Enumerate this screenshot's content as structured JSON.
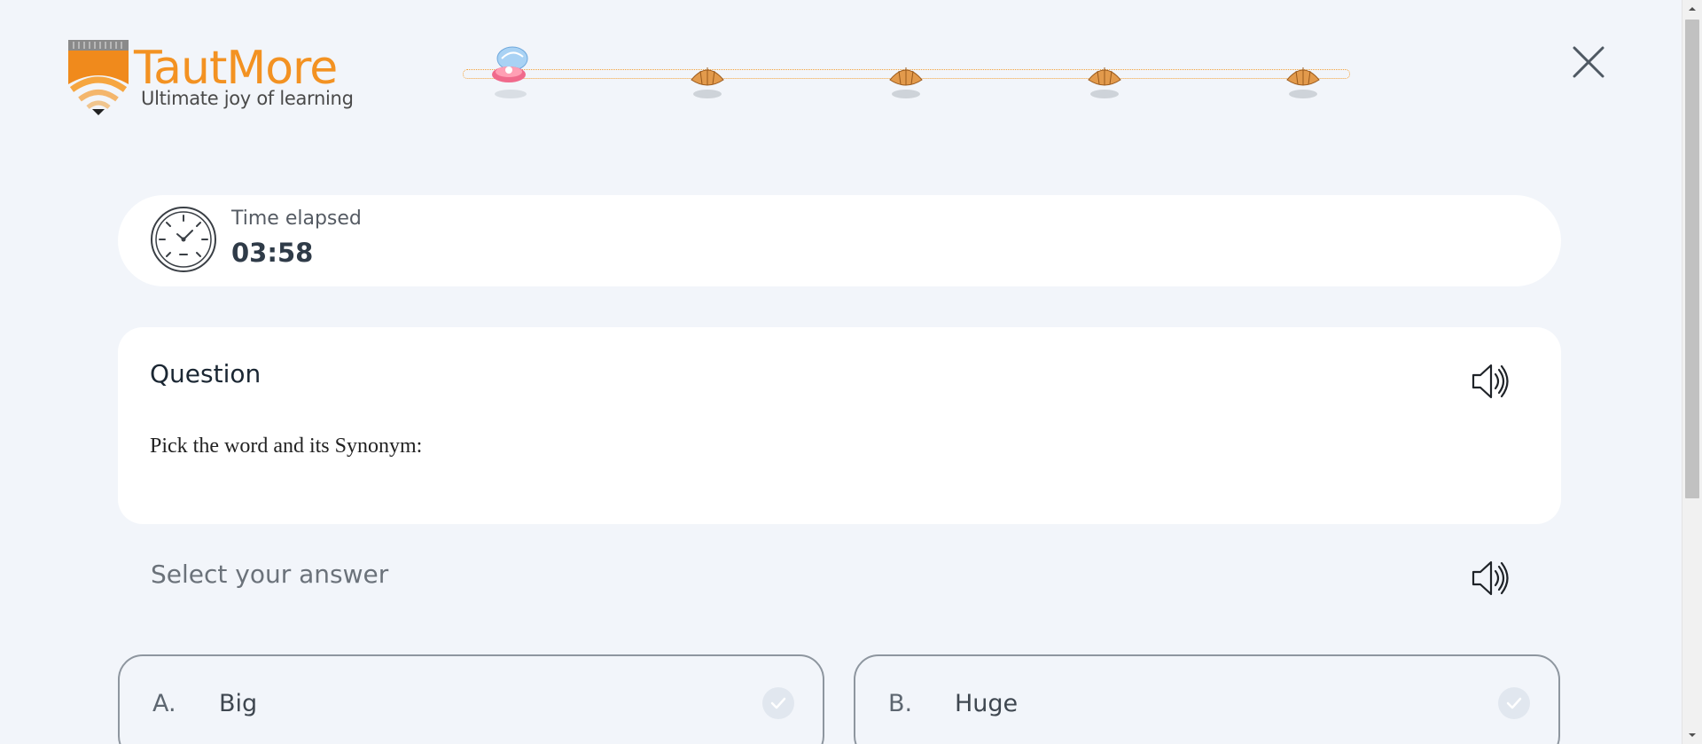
{
  "app": {
    "logo": {
      "name": "TautMore",
      "tagline": "Ultimate joy of learning"
    }
  },
  "progress": {
    "total_steps": 5,
    "current_step": 1
  },
  "icons": {
    "close": "close-icon",
    "timer": "clock-icon",
    "speaker": "speaker-icon",
    "check": "check-icon"
  },
  "timer": {
    "label": "Time elapsed",
    "value": "03:58"
  },
  "question": {
    "title": "Question",
    "text": "Pick the word and its Synonym:"
  },
  "answers": {
    "prompt": "Select your answer",
    "options": [
      {
        "letter": "A.",
        "text": "Big"
      },
      {
        "letter": "B.",
        "text": "Huge"
      }
    ]
  },
  "colors": {
    "background": "#f2f5fa",
    "brand_orange": "#f39222",
    "card": "#ffffff",
    "option_border": "#8e969f"
  }
}
